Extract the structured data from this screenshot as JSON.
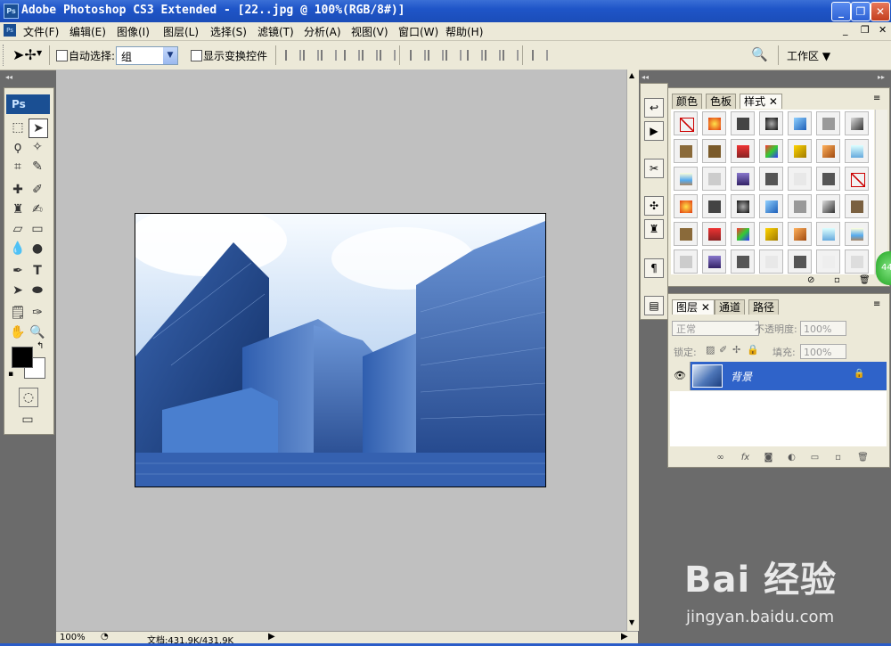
{
  "window": {
    "app_icon": "Ps",
    "title": "Adobe Photoshop CS3 Extended - [22..jpg @ 100%(RGB/8#)]",
    "controls": [
      "minimize-icon",
      "restore-icon",
      "close-icon"
    ]
  },
  "menubar": {
    "items": [
      "文件(F)",
      "编辑(E)",
      "图像(I)",
      "图层(L)",
      "选择(S)",
      "滤镜(T)",
      "分析(A)",
      "视图(V)",
      "窗口(W)",
      "帮助(H)"
    ],
    "doc_controls": [
      "minimize-icon",
      "restore-icon",
      "close-icon"
    ]
  },
  "options_bar": {
    "auto_select_label": "自动选择:",
    "auto_select_value": "组",
    "show_transform_label": "显示变换控件",
    "workspace_label": "工作区 ▼"
  },
  "toolbox": {
    "logo": "Ps",
    "tools": [
      "marquee-icon",
      "move-icon",
      "lasso-icon",
      "magic-wand-icon",
      "crop-icon",
      "slice-icon",
      "healing-brush-icon",
      "brush-icon",
      "clone-stamp-icon",
      "history-brush-icon",
      "eraser-icon",
      "gradient-icon",
      "blur-icon",
      "dodge-icon",
      "pen-icon",
      "type-icon",
      "path-select-icon",
      "shape-icon",
      "notes-icon",
      "eyedropper-icon",
      "hand-icon",
      "zoom-icon"
    ],
    "foreground_color": "#000000",
    "background_color": "#ffffff"
  },
  "styles_panel": {
    "tabs": [
      "颜色",
      "色板",
      "样式"
    ],
    "active_tab": "样式"
  },
  "layers_panel": {
    "tabs": [
      "图层",
      "通道",
      "路径"
    ],
    "blend_mode": "正常",
    "opacity_label": "不透明度:",
    "opacity_value": "100%",
    "lock_label": "锁定:",
    "fill_label": "填充:",
    "fill_value": "100%",
    "layer_name": "背景"
  },
  "status_bar": {
    "zoom": "100%",
    "doc_info": "文档:431.9K/431.9K"
  },
  "watermark": {
    "logo": "Bai  经验",
    "url": "jingyan.baidu.com"
  },
  "badge": {
    "text": "44"
  }
}
